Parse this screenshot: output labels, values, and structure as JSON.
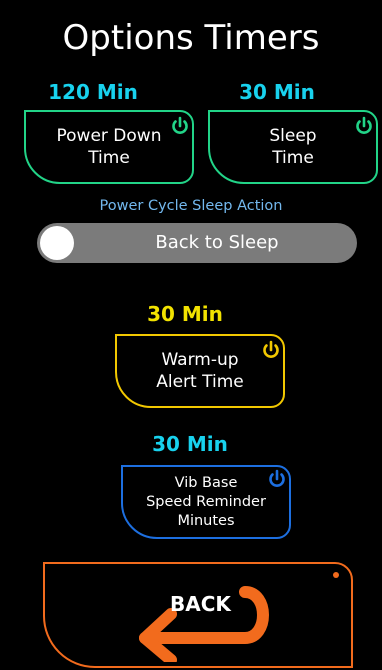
{
  "page": {
    "title": "Options Timers"
  },
  "power_down": {
    "value": "120 Min",
    "label": "Power Down\nTime"
  },
  "sleep": {
    "value": "30 Min",
    "label": "Sleep\nTime"
  },
  "power_cycle": {
    "caption": "Power Cycle Sleep Action",
    "toggle_label": "Back to Sleep",
    "toggle_on": false
  },
  "warmup": {
    "value": "30 Min",
    "label": "Warm-up\nAlert Time"
  },
  "vib_base": {
    "value": "30 Min",
    "label": "Vib Base\nSpeed Reminder\nMinutes"
  },
  "back": {
    "label": "BACK"
  },
  "colors": {
    "cyan": "#18d2ee",
    "green": "#22d488",
    "yellow": "#f2e200",
    "gold": "#f2c800",
    "blue": "#1d6fe0",
    "orange": "#f26b1d",
    "toggle_track": "#7b7b7b",
    "caption": "#73b8ee"
  },
  "icons": {
    "timer_buttons": "power-icon",
    "back_button": "back-arrow-icon"
  }
}
